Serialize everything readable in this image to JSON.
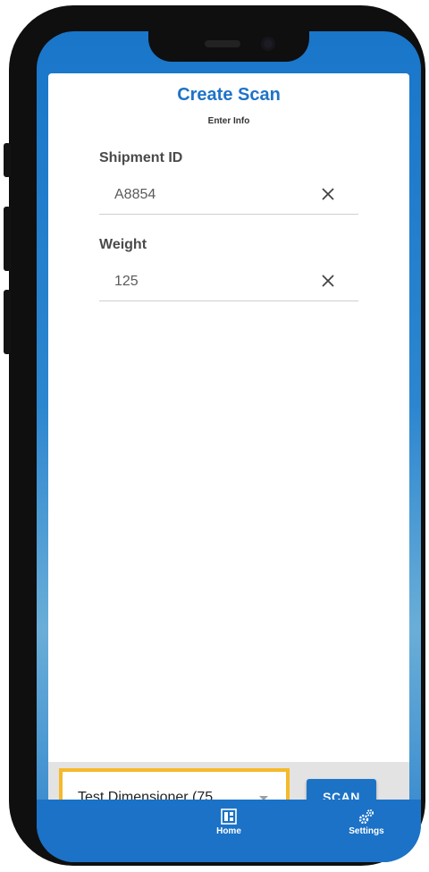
{
  "header": {
    "title": "Create Scan",
    "subtitle": "Enter Info"
  },
  "form": {
    "fields": [
      {
        "label": "Shipment ID",
        "value": "A8854"
      },
      {
        "label": "Weight",
        "value": "125"
      }
    ]
  },
  "scanner": {
    "selected_device": "Test Dimensioner (75....",
    "scan_label": "SCAN"
  },
  "nav": {
    "items": [
      {
        "label": "Home",
        "icon": "home-grid-icon"
      },
      {
        "label": "Settings",
        "icon": "gears-icon"
      }
    ]
  },
  "colors": {
    "accent": "#1e73c8",
    "highlight": "#f5b92a",
    "nav_bg": "#1b72c6"
  }
}
